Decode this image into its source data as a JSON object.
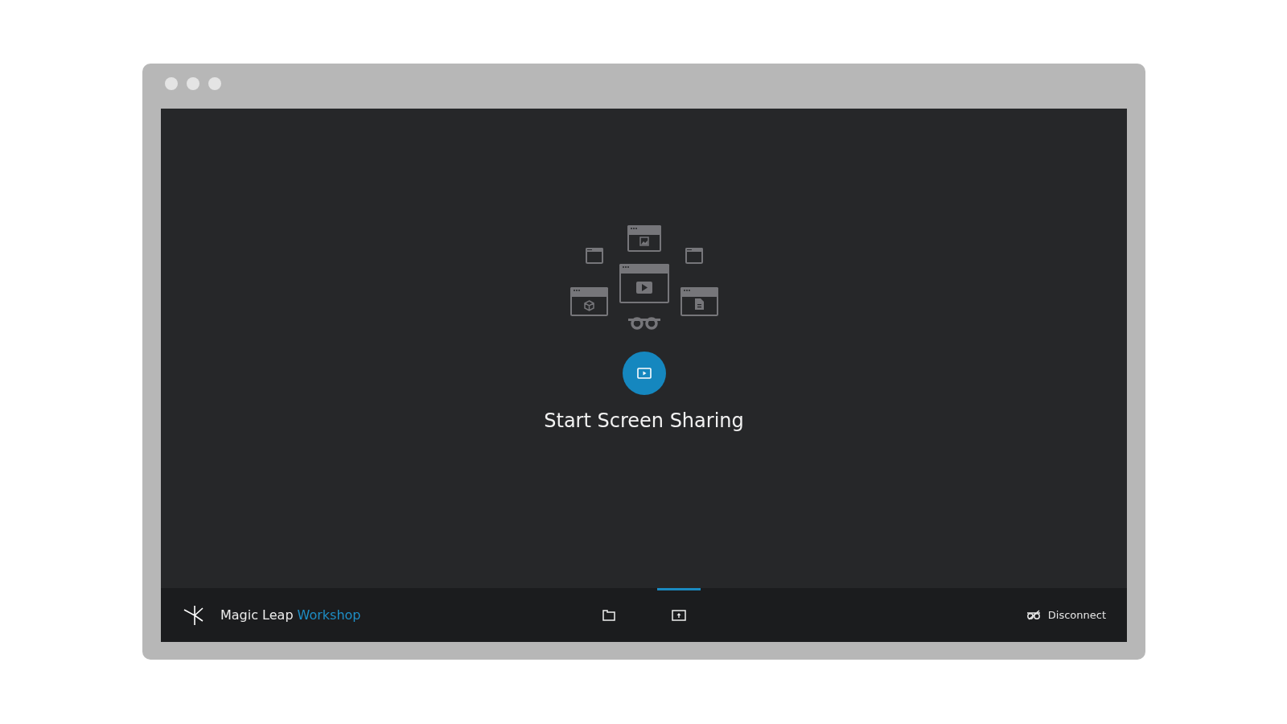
{
  "main": {
    "title": "Start Screen Sharing"
  },
  "brand": {
    "name": "Magic Leap",
    "product": "Workshop"
  },
  "tabs": [
    {
      "kind": "folder",
      "selected": false
    },
    {
      "kind": "share",
      "selected": true
    }
  ],
  "disconnect": {
    "label": "Disconnect"
  }
}
